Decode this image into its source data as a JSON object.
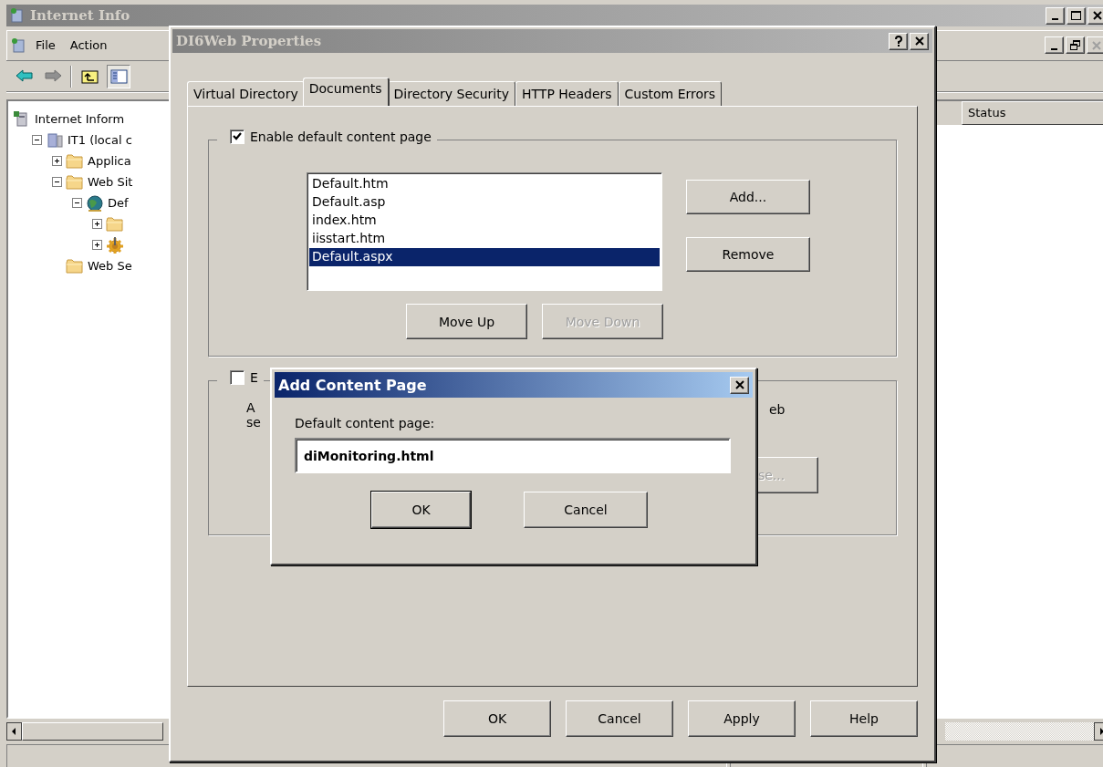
{
  "main_window": {
    "title": "Internet Info",
    "title_buttons": [
      {
        "kind": "minimize"
      },
      {
        "kind": "maximize"
      },
      {
        "kind": "close"
      }
    ],
    "menu": [
      "File",
      "Action"
    ],
    "mdi_buttons": [
      {
        "kind": "minimize",
        "disabled": false
      },
      {
        "kind": "restore",
        "disabled": false
      },
      {
        "kind": "close",
        "disabled": true
      }
    ],
    "toolbar": [
      {
        "kind": "back"
      },
      {
        "kind": "forward"
      },
      {
        "kind": "separator"
      },
      {
        "kind": "up-folder"
      },
      {
        "kind": "tree-toggle",
        "pressed": true
      }
    ],
    "tree": [
      {
        "label": "Internet Inform",
        "kind": "server",
        "children": [
          {
            "label": "IT1 (local c",
            "kind": "computer",
            "expanded": true,
            "children": [
              {
                "label": "Applica",
                "kind": "folder",
                "expanded": false
              },
              {
                "label": "Web Sit",
                "kind": "folder",
                "expanded": true,
                "children": [
                  {
                    "label": "Def",
                    "kind": "globe",
                    "expanded": true,
                    "children": [
                      {
                        "kind": "folder",
                        "expanded": false
                      },
                      {
                        "kind": "gear",
                        "expanded": false
                      }
                    ]
                  }
                ]
              },
              {
                "label": "Web Se",
                "kind": "folder"
              }
            ]
          }
        ]
      }
    ],
    "list": {
      "columns": [
        "Status"
      ]
    }
  },
  "properties_dialog": {
    "title": "DI6Web Properties",
    "title_buttons": [
      {
        "kind": "help"
      },
      {
        "kind": "close"
      }
    ],
    "tabs": [
      {
        "label": "Virtual Directory",
        "selected": false
      },
      {
        "label": "Documents",
        "selected": true
      },
      {
        "label": "Directory Security",
        "selected": false
      },
      {
        "label": "HTTP Headers",
        "selected": false
      },
      {
        "label": "Custom Errors",
        "selected": false
      }
    ],
    "default_content": {
      "label": "Enable default content page",
      "checked": true,
      "pages": [
        {
          "name": "Default.htm",
          "selected": false
        },
        {
          "name": "Default.asp",
          "selected": false
        },
        {
          "name": "index.htm",
          "selected": false
        },
        {
          "name": "iisstart.htm",
          "selected": false
        },
        {
          "name": "Default.aspx",
          "selected": true
        }
      ],
      "side_buttons": [
        {
          "label": "Add...",
          "disabled": false
        },
        {
          "label": "Remove",
          "disabled": false
        }
      ],
      "move_buttons": [
        {
          "label": "Move Up",
          "disabled": false
        },
        {
          "label": "Move Down",
          "disabled": true
        }
      ]
    },
    "footer_group": {
      "label": "E",
      "checked": false,
      "left_text": [
        "A",
        "se"
      ],
      "right_text": "eb",
      "button": {
        "label": "se...",
        "disabled": true
      }
    },
    "buttons": [
      "OK",
      "Cancel",
      "Apply",
      "Help"
    ]
  },
  "add_dialog": {
    "title": "Add Content Page",
    "field_label": "Default content page:",
    "value": "diMonitoring.html",
    "buttons": [
      {
        "label": "OK",
        "default": true
      },
      {
        "label": "Cancel",
        "default": false
      }
    ]
  }
}
